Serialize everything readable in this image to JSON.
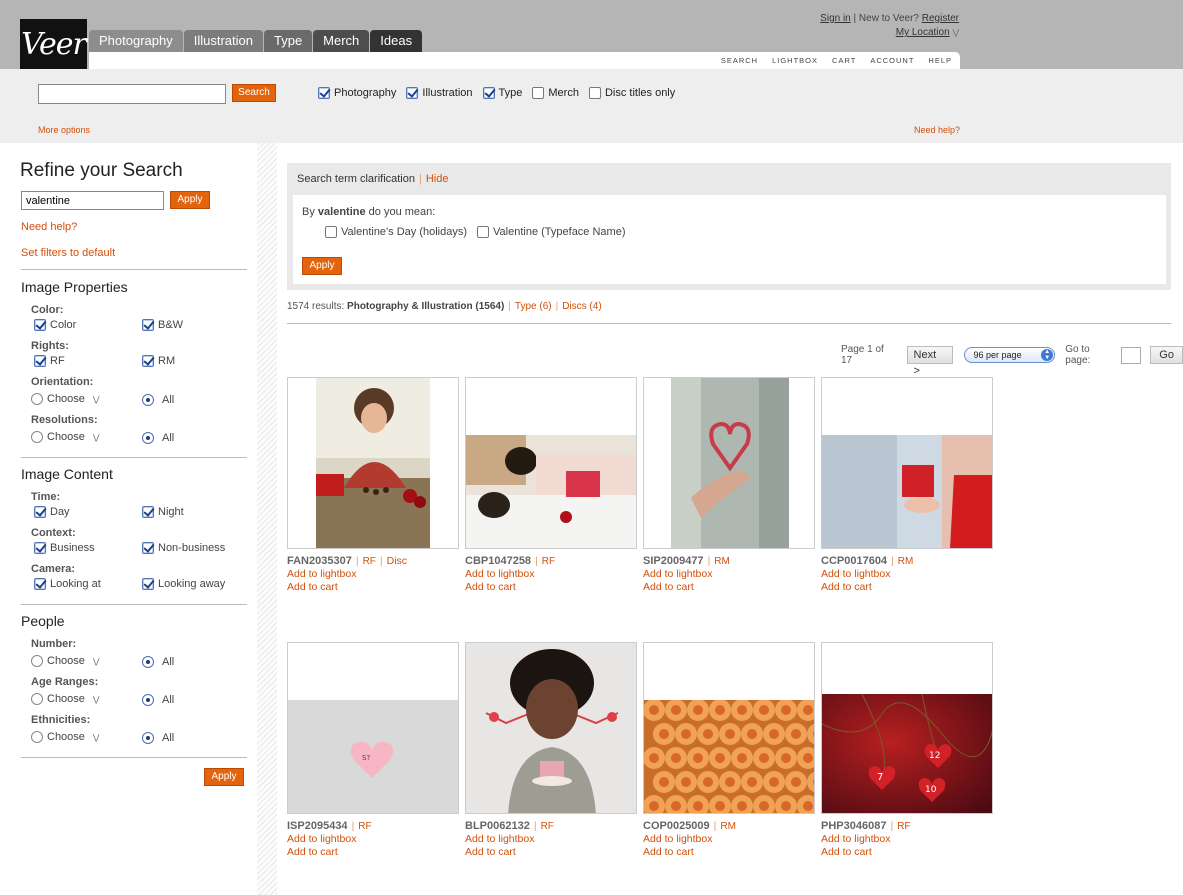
{
  "brand": {
    "logo_text": "Veer"
  },
  "nav": {
    "tabs": [
      {
        "label": "Photography"
      },
      {
        "label": "Illustration"
      },
      {
        "label": "Type"
      },
      {
        "label": "Merch"
      },
      {
        "label": "Ideas"
      }
    ],
    "tools": [
      "SEARCH",
      "LIGHTBOX",
      "CART",
      "ACCOUNT",
      "HELP"
    ]
  },
  "account": {
    "sign_in": "Sign in",
    "new_to": "New to Veer?",
    "register": "Register",
    "location": "My Location"
  },
  "search": {
    "query": "",
    "button": "Search",
    "scopes": [
      {
        "label": "Photography",
        "checked": true
      },
      {
        "label": "Illustration",
        "checked": true
      },
      {
        "label": "Type",
        "checked": true
      },
      {
        "label": "Merch",
        "checked": false
      },
      {
        "label": "Disc titles only",
        "checked": false
      }
    ],
    "more_options": "More options",
    "need_help": "Need help?"
  },
  "refine": {
    "title": "Refine your Search",
    "query": "valentine",
    "apply": "Apply",
    "need_help": "Need help?",
    "set_defaults": "Set filters to default",
    "image_properties": {
      "heading": "Image Properties",
      "color_label": "Color:",
      "color": [
        {
          "label": "Color",
          "checked": true
        },
        {
          "label": "B&W",
          "checked": true
        }
      ],
      "rights_label": "Rights:",
      "rights": [
        {
          "label": "RF",
          "checked": true
        },
        {
          "label": "RM",
          "checked": true
        }
      ],
      "orientation_label": "Orientation:",
      "resolutions_label": "Resolutions:",
      "choose": "Choose",
      "all": "All"
    },
    "image_content": {
      "heading": "Image Content",
      "time_label": "Time:",
      "time": [
        {
          "label": "Day",
          "checked": true
        },
        {
          "label": "Night",
          "checked": true
        }
      ],
      "context_label": "Context:",
      "context": [
        {
          "label": "Business",
          "checked": true
        },
        {
          "label": "Non-business",
          "checked": true
        }
      ],
      "camera_label": "Camera:",
      "camera": [
        {
          "label": "Looking at",
          "checked": true
        },
        {
          "label": "Looking away",
          "checked": true
        }
      ]
    },
    "people": {
      "heading": "People",
      "number_label": "Number:",
      "age_label": "Age Ranges:",
      "ethnicity_label": "Ethnicities:"
    },
    "bottom_apply": "Apply"
  },
  "clarification": {
    "heading": "Search term clarification",
    "hide": "Hide",
    "question_prefix": "By",
    "term": "valentine",
    "question_suffix": "do you mean:",
    "options": [
      {
        "label": "Valentine's Day (holidays)",
        "checked": false
      },
      {
        "label": "Valentine (Typeface Name)",
        "checked": false
      }
    ],
    "apply": "Apply"
  },
  "results": {
    "count_text": "1574 results:",
    "primary": "Photography & Illustration (1564)",
    "type_link": "Type (6)",
    "discs_link": "Discs (4)"
  },
  "pager": {
    "page_text": "Page 1 of 17",
    "next": "Next >",
    "per_page": "96 per page",
    "goto_label": "Go to page:",
    "go": "Go"
  },
  "images": [
    {
      "code": "FAN2035307",
      "license": "RF",
      "extra": "Disc",
      "lightbox": "Add to lightbox",
      "cart": "Add to cart",
      "alt": "woman leaning on table with roses and chocolates"
    },
    {
      "code": "CBP1047258",
      "license": "RF",
      "extra": "",
      "lightbox": "Add to lightbox",
      "cart": "Add to cart",
      "alt": "man giving gift to sleeping woman"
    },
    {
      "code": "SIP2009477",
      "license": "RM",
      "extra": "",
      "lightbox": "Add to lightbox",
      "cart": "Add to cart",
      "alt": "heart drawn on foggy glass"
    },
    {
      "code": "CCP0017604",
      "license": "RM",
      "extra": "",
      "lightbox": "Add to lightbox",
      "cart": "Add to cart",
      "alt": "woman holding red gift box"
    },
    {
      "code": "ISP2095434",
      "license": "RF",
      "extra": "",
      "lightbox": "Add to lightbox",
      "cart": "Add to cart",
      "alt": "pink heart sticky note"
    },
    {
      "code": "BLP0062132",
      "license": "RF",
      "extra": "",
      "lightbox": "Add to lightbox",
      "cart": "Add to cart",
      "alt": "smiling woman holding cupcake"
    },
    {
      "code": "COP0025009",
      "license": "RM",
      "extra": "",
      "lightbox": "Add to lightbox",
      "cart": "Add to cart",
      "alt": "orange roses"
    },
    {
      "code": "PHP3046087",
      "license": "RF",
      "extra": "",
      "lightbox": "Add to lightbox",
      "cart": "Add to cart",
      "alt": "hanging numbered heart ornaments"
    }
  ],
  "colors": {
    "accent": "#e4640e",
    "link": "#d2500a",
    "header_bg": "#b5b5b5",
    "band_bg": "#eeeeee"
  }
}
